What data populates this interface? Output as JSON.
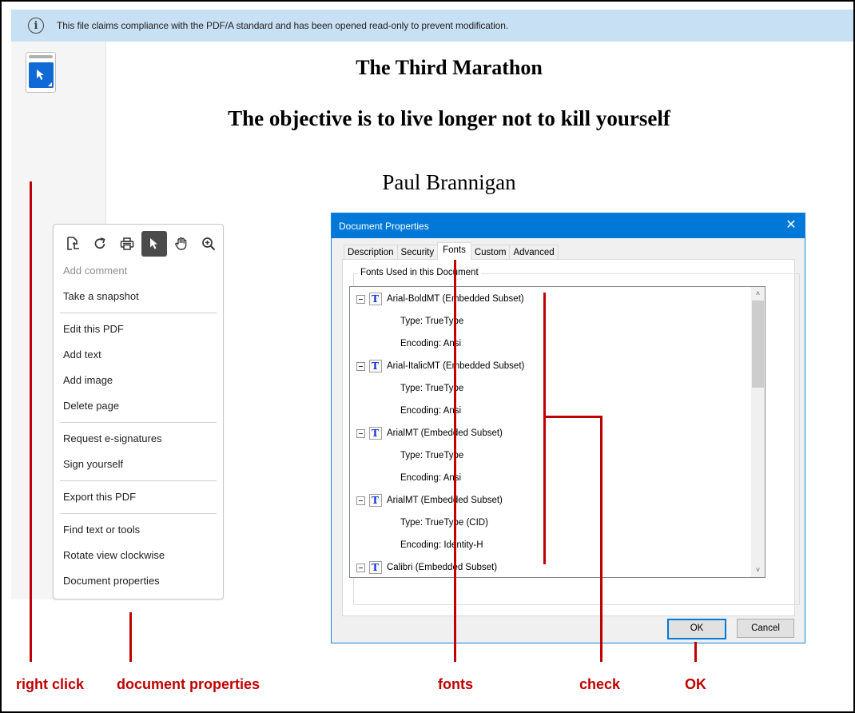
{
  "banner": {
    "icon": "info-icon",
    "message": "This file claims compliance with the PDF/A standard and has been opened read-only to prevent modification."
  },
  "rail": {
    "tool": "select-tool"
  },
  "document": {
    "title": "The Third Marathon",
    "subtitle": "The objective is to live longer not to kill yourself",
    "author": "Paul Brannigan"
  },
  "context_menu": {
    "toolbar": [
      {
        "icon": "page-crop-icon",
        "active": false
      },
      {
        "icon": "rotate-icon",
        "active": false
      },
      {
        "icon": "print-icon",
        "active": false
      },
      {
        "icon": "select-pointer-icon",
        "active": true
      },
      {
        "icon": "hand-icon",
        "active": false
      },
      {
        "icon": "zoom-in-icon",
        "active": false
      }
    ],
    "items": [
      {
        "label": "Add comment",
        "disabled": true
      },
      {
        "label": "Take a snapshot"
      },
      {
        "label": "Edit this PDF"
      },
      {
        "label": "Add text"
      },
      {
        "label": "Add image"
      },
      {
        "label": "Delete page"
      },
      {
        "label": "Request e-signatures"
      },
      {
        "label": "Sign yourself"
      },
      {
        "label": "Export this PDF"
      },
      {
        "label": "Find text or tools"
      },
      {
        "label": "Rotate view clockwise"
      },
      {
        "label": "Document properties"
      }
    ]
  },
  "dialog": {
    "title": "Document Properties",
    "close": "✕",
    "tabs": [
      {
        "label": "Description",
        "active": false
      },
      {
        "label": "Security",
        "active": false
      },
      {
        "label": "Fonts",
        "active": true
      },
      {
        "label": "Custom",
        "active": false
      },
      {
        "label": "Advanced",
        "active": false
      }
    ],
    "group_label": "Fonts Used in this Document",
    "fonts": [
      {
        "name": "Arial-BoldMT (Embedded Subset)",
        "type": "Type: TrueType",
        "encoding": "Encoding: Ansi"
      },
      {
        "name": "Arial-ItalicMT (Embedded Subset)",
        "type": "Type: TrueType",
        "encoding": "Encoding: Ansi"
      },
      {
        "name": "ArialMT (Embedded Subset)",
        "type": "Type: TrueType",
        "encoding": "Encoding: Ansi"
      },
      {
        "name": "ArialMT (Embedded Subset)",
        "type": "Type: TrueType (CID)",
        "encoding": "Encoding: Identity-H"
      },
      {
        "name": "Calibri (Embedded Subset)"
      }
    ],
    "font_icon_glyph": "T",
    "scroll_up": "˄",
    "scroll_down": "˅",
    "ok_label": "OK",
    "cancel_label": "Cancel"
  },
  "annotations": {
    "color": "#c00000",
    "labels": [
      "right click",
      "document properties",
      "fonts",
      "check",
      "OK"
    ]
  }
}
